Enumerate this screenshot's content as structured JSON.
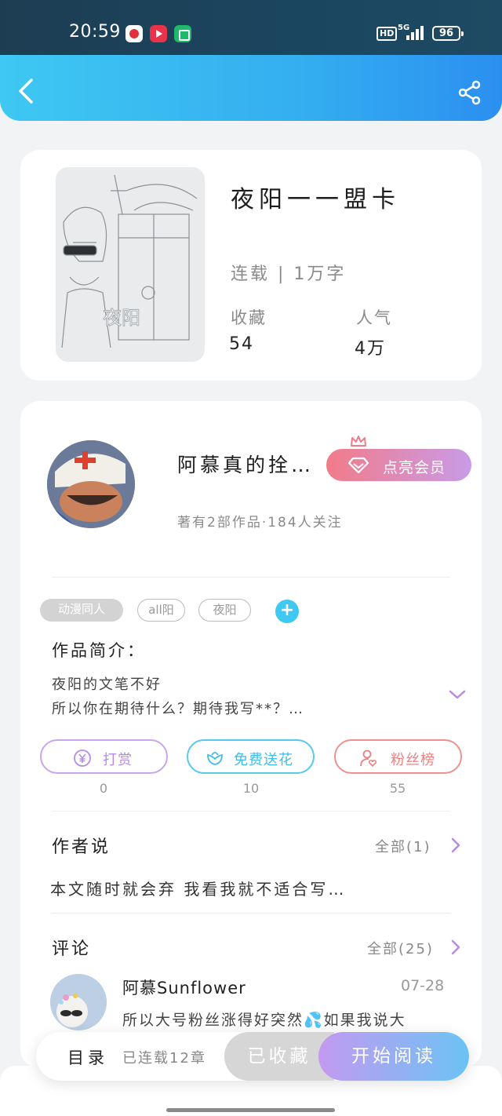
{
  "status_bar": {
    "time": "20:59",
    "hd": "HD",
    "network": "5G",
    "battery": "96"
  },
  "book": {
    "title": "夜阳一一盟卡",
    "status": "连载 | 1万字",
    "stats": [
      {
        "label": "收藏",
        "value": "54"
      },
      {
        "label": "人气",
        "value": "4万"
      }
    ],
    "cover_signature": "夜阳"
  },
  "author": {
    "name": "阿慕真的拴…",
    "meta": "著有2部作品·184人关注",
    "vip_label": "点亮会员"
  },
  "tags": [
    "动漫同人",
    "all阳",
    "夜阳"
  ],
  "tag_add": "+",
  "intro": {
    "title": "作品简介：",
    "lines": [
      "夜阳的文笔不好",
      "所以你在期待什么？期待我写**？…"
    ]
  },
  "actions": [
    {
      "label": "打赏",
      "count": "0"
    },
    {
      "label": "免费送花",
      "count": "10"
    },
    {
      "label": "粉丝榜",
      "count": "55"
    }
  ],
  "author_says": {
    "title": "作者说",
    "more": "全部(1)",
    "text": "本文随时就会弃 我看我就不适合写…"
  },
  "comments": {
    "title": "评论",
    "more": "全部(25)",
    "items": [
      {
        "name": "阿慕Sunflower",
        "date": "07-28",
        "text": "所以大号粉丝涨得好突然💦如果我说大"
      }
    ]
  },
  "bottom_bar": {
    "toc": "目录",
    "chapters": "已连载12章",
    "collected": "已收藏",
    "read": "开始阅读"
  },
  "colors": {
    "header_start": "#3fc8f2",
    "header_end": "#2b8ff0",
    "reward": "#b58ce6",
    "flower": "#3fbde8",
    "fans": "#ec8080",
    "chevron": "#b58ce6"
  }
}
